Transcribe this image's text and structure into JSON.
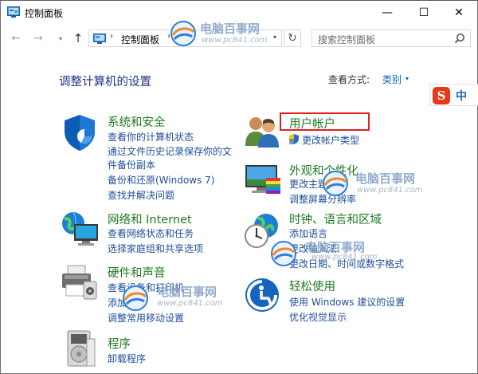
{
  "window": {
    "title": "控制面板",
    "min_glyph": "—",
    "max_glyph": "☐",
    "close_glyph": "✕"
  },
  "nav": {
    "back": "←",
    "forward": "→",
    "dropdown": "▾",
    "up": "↑",
    "refresh": "↻"
  },
  "address": {
    "sep": "›",
    "path": "控制面板",
    "dropdown": "▾"
  },
  "search": {
    "placeholder": "搜索控制面板"
  },
  "content": {
    "heading": "调整计算机的设置",
    "view_by_label": "查看方式:",
    "view_by_value": "类别",
    "view_by_arrow": "▾"
  },
  "ime": {
    "logo": "S",
    "mode": "中",
    "sep": "·"
  },
  "categories": [
    {
      "title": "系统和安全",
      "icon": "shield-icon",
      "links": [
        "查看你的计算机状态",
        "通过文件历史记录保存你的文",
        "件备份副本",
        "备份和还原(Windows 7)",
        "查找并解决问题"
      ]
    },
    {
      "title": "用户帐户",
      "icon": "users-icon",
      "links": [
        "更改帐户类型"
      ]
    },
    {
      "title": "网络和 Internet",
      "icon": "network-icon",
      "links": [
        "查看网络状态和任务",
        "选择家庭组和共享选项"
      ]
    },
    {
      "title": "外观和个性化",
      "icon": "appearance-icon",
      "links": [
        "更改主题",
        "调整屏幕分辨率"
      ]
    },
    {
      "title": "硬件和声音",
      "icon": "printer-icon",
      "links": [
        "查看设备和打印机",
        "添加设备",
        "调整常用移动设置"
      ]
    },
    {
      "title": "时钟、语言和区域",
      "icon": "clock-globe-icon",
      "links": [
        "添加语言",
        "更改输入法",
        "更改日期、时间或数字格式"
      ]
    },
    {
      "title": "轻松使用",
      "icon": "ease-of-access-icon",
      "links": [
        "使用 Windows 建议的设置",
        "优化视觉显示"
      ]
    },
    {
      "title": "程序",
      "icon": "programs-icon",
      "links": [
        "卸载程序"
      ]
    }
  ],
  "watermark": {
    "name": "电脑百事网",
    "url": "www.pc841.com"
  },
  "colors": {
    "category_title": "#1d7a1d",
    "link": "#1e4e9c",
    "heading": "#1e3287",
    "highlight_box": "#e02020"
  }
}
